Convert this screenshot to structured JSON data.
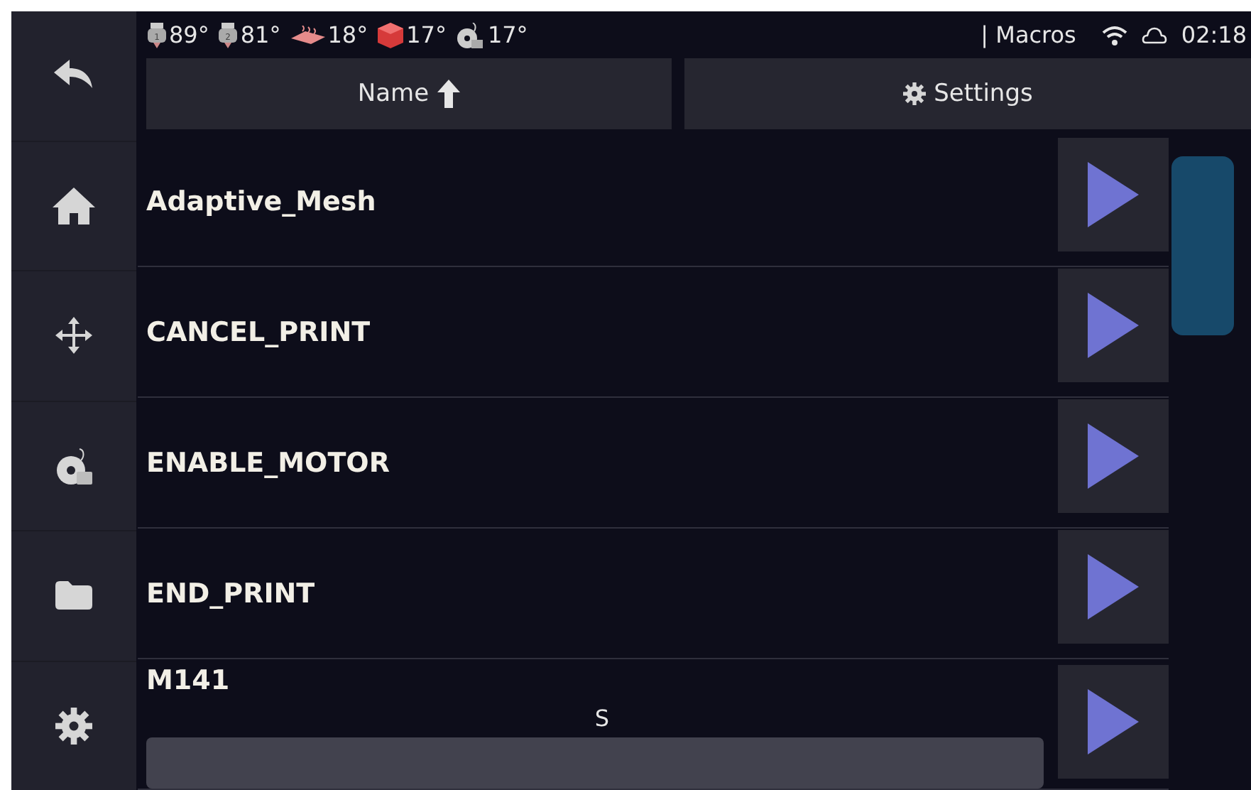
{
  "status_bar": {
    "sensors": [
      {
        "kind": "extruder",
        "badge": "1",
        "reading": "89°"
      },
      {
        "kind": "extruder",
        "badge": "2",
        "reading": "81°"
      },
      {
        "kind": "bed",
        "reading": "18°"
      },
      {
        "kind": "chamber",
        "reading": "17°"
      },
      {
        "kind": "spool",
        "reading": "17°"
      }
    ],
    "title": "| Macros",
    "time": "02:18"
  },
  "sidebar": {
    "items": [
      {
        "kind": "back"
      },
      {
        "kind": "home"
      },
      {
        "kind": "move"
      },
      {
        "kind": "spool"
      },
      {
        "kind": "folder"
      },
      {
        "kind": "settings"
      }
    ]
  },
  "sort_buttons": [
    {
      "label": "Name",
      "kind": "sort"
    },
    {
      "label": "Settings",
      "kind": "settings"
    }
  ],
  "macros": [
    {
      "name": "Adaptive_Mesh"
    },
    {
      "name": "CANCEL_PRINT"
    },
    {
      "name": "ENABLE_MOTOR"
    },
    {
      "name": "END_PRINT"
    },
    {
      "name": "M141",
      "params": [
        {
          "label": "S"
        }
      ]
    }
  ]
}
